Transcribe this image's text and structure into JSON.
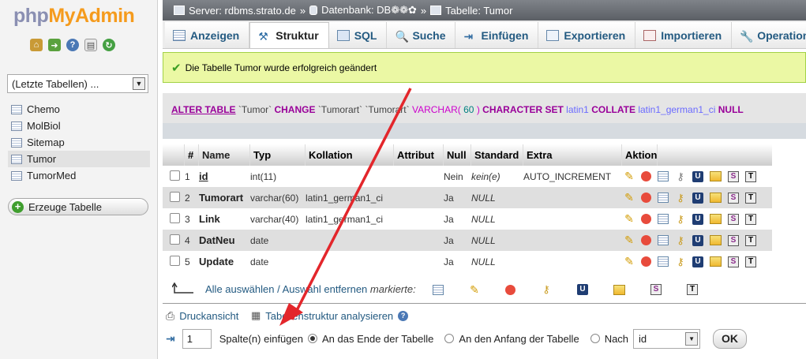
{
  "app": {
    "logo_php": "php",
    "logo_myadmin": "MyAdmin"
  },
  "nav": {
    "recent_tables": "(Letzte Tabellen) ...",
    "tables": [
      "Chemo",
      "MolBiol",
      "Sitemap",
      "Tumor",
      "TumorMed"
    ],
    "active_table": "Tumor",
    "new_table": "Erzeuge Tabelle",
    "icons": [
      "home-icon",
      "logout-icon",
      "help-icon",
      "docs-icon",
      "reload-icon"
    ]
  },
  "breadcrumb": {
    "server": "Server: rdbms.strato.de",
    "sep1": "»",
    "database": "Datenbank: DB❁❁✿",
    "sep2": "»",
    "table": "Tabelle: Tumor"
  },
  "tabs": [
    {
      "label": "Anzeigen",
      "icon": "browse-icon"
    },
    {
      "label": "Struktur",
      "icon": "structure-icon",
      "active": true
    },
    {
      "label": "SQL",
      "icon": "sql-icon"
    },
    {
      "label": "Suche",
      "icon": "search-icon"
    },
    {
      "label": "Einfügen",
      "icon": "insert-icon"
    },
    {
      "label": "Exportieren",
      "icon": "export-icon"
    },
    {
      "label": "Importieren",
      "icon": "import-icon"
    },
    {
      "label": "Operationen",
      "icon": "operations-icon"
    }
  ],
  "message": {
    "text": "Die Tabelle Tumor wurde erfolgreich geändert"
  },
  "sql": {
    "alter": "ALTER TABLE",
    "table": "`Tumor`",
    "change": "CHANGE",
    "col_old": "`Tumorart`",
    "col_new": "`Tumorart`",
    "varchar": "VARCHAR",
    "open": "(",
    "len": "60",
    "close": ")",
    "charset_kw": "CHARACTER SET",
    "charset": "latin1",
    "collate_kw": "COLLATE",
    "collation": "latin1_german1_ci",
    "null_kw": "NULL"
  },
  "structure": {
    "headers": {
      "num": "#",
      "name": "Name",
      "type": "Typ",
      "collation": "Kollation",
      "attribute": "Attribut",
      "null": "Null",
      "default": "Standard",
      "extra": "Extra",
      "action": "Aktion"
    },
    "rows": [
      {
        "num": "1",
        "name": "id",
        "type": "int(11)",
        "collation": "",
        "attribute": "",
        "null": "Nein",
        "default": "kein(e)",
        "extra": "AUTO_INCREMENT"
      },
      {
        "num": "2",
        "name": "Tumorart",
        "type": "varchar(60)",
        "collation": "latin1_german1_ci",
        "attribute": "",
        "null": "Ja",
        "default": "NULL",
        "extra": ""
      },
      {
        "num": "3",
        "name": "Link",
        "type": "varchar(40)",
        "collation": "latin1_german1_ci",
        "attribute": "",
        "null": "Ja",
        "default": "NULL",
        "extra": ""
      },
      {
        "num": "4",
        "name": "DatNeu",
        "type": "date",
        "collation": "",
        "attribute": "",
        "null": "Ja",
        "default": "NULL",
        "extra": ""
      },
      {
        "num": "5",
        "name": "Update",
        "type": "date",
        "collation": "",
        "attribute": "",
        "null": "Ja",
        "default": "NULL",
        "extra": ""
      }
    ],
    "action_icons": [
      "edit-icon",
      "drop-icon",
      "browse-icon",
      "primary-key-icon",
      "unique-icon",
      "index-icon",
      "spatial-icon",
      "fulltext-icon"
    ]
  },
  "bulk": {
    "select_all": "Alle auswählen",
    "slash": "/",
    "deselect": "Auswahl entfernen",
    "marked": "markierte:",
    "icons": [
      "browse-icon",
      "edit-icon",
      "drop-icon",
      "primary-key-icon",
      "unique-icon",
      "index-icon",
      "spatial-icon",
      "fulltext-icon"
    ]
  },
  "footer": {
    "print_view": "Druckansicht",
    "analyze": "Tabellenstruktur analysieren",
    "add_count": "1",
    "add_label": "Spalte(n) einfügen",
    "opt_end": "An das Ende der Tabelle",
    "opt_start": "An den Anfang der Tabelle",
    "opt_after": "Nach",
    "after_value": "id",
    "ok": "OK"
  },
  "colors": {
    "accent_link": "#235a81",
    "success_bg": "#ebf8a4",
    "annotation_arrow": "#e3262b",
    "logo_orange": "#f59b1d"
  }
}
